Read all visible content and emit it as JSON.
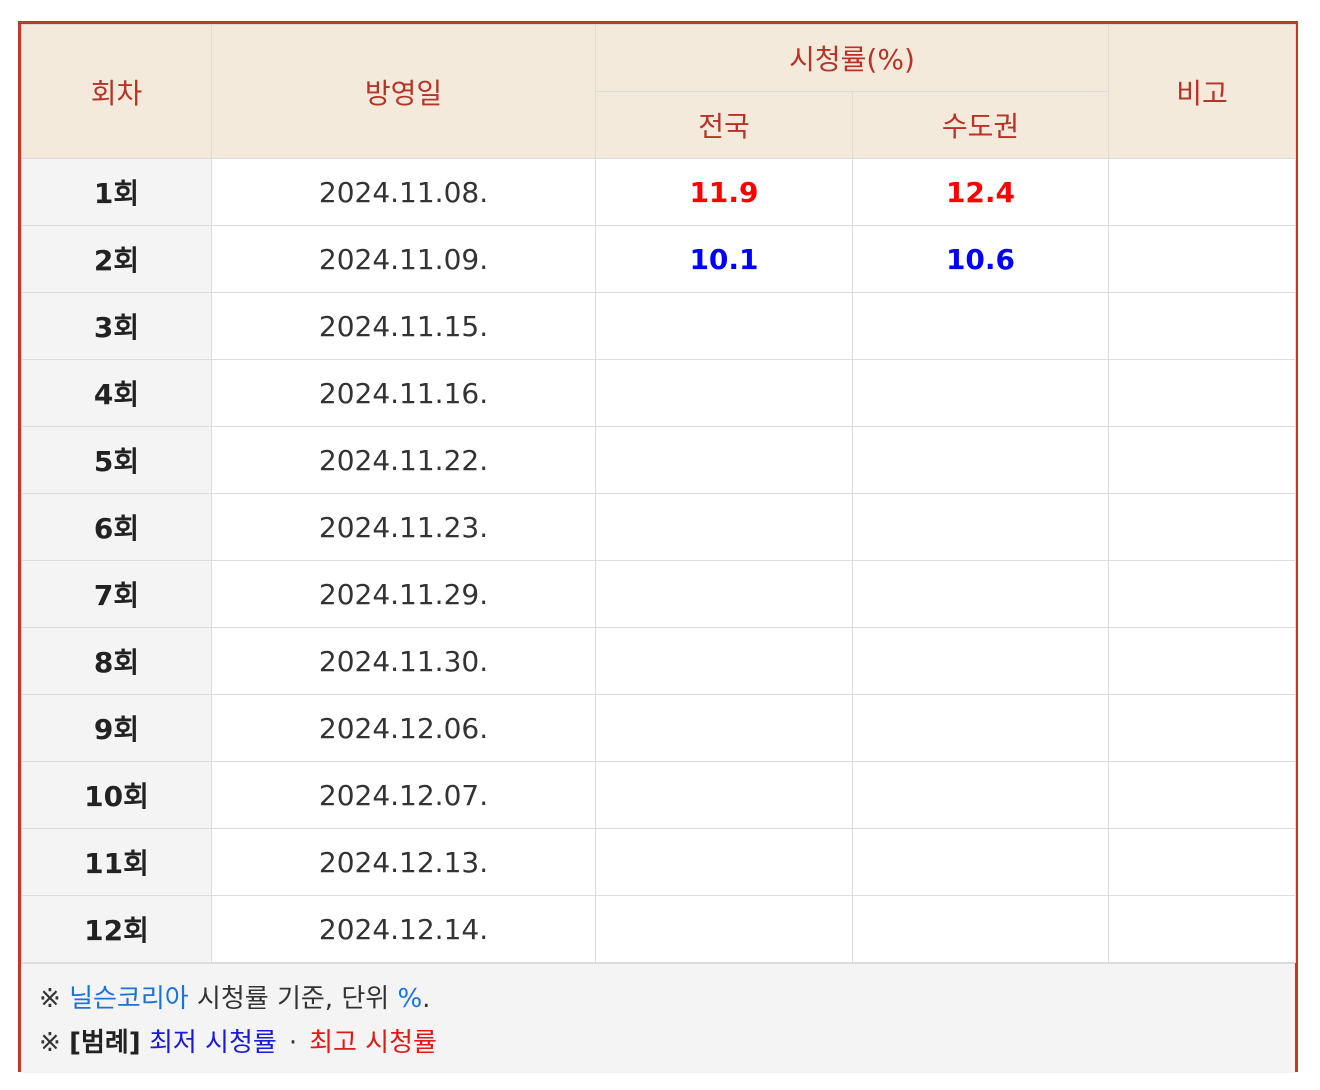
{
  "table": {
    "headers": {
      "episode": "회차",
      "air_date": "방영일",
      "ratings": "시청률(%)",
      "nationwide": "전국",
      "capital_area": "수도권",
      "remarks": "비고"
    },
    "rows": [
      {
        "episode": "1회",
        "date": "2024.11.08.",
        "nationwide": "11.9",
        "capital": "12.4",
        "remark": ""
      },
      {
        "episode": "2회",
        "date": "2024.11.09.",
        "nationwide": "10.1",
        "capital": "10.6",
        "remark": ""
      },
      {
        "episode": "3회",
        "date": "2024.11.15.",
        "nationwide": "",
        "capital": "",
        "remark": ""
      },
      {
        "episode": "4회",
        "date": "2024.11.16.",
        "nationwide": "",
        "capital": "",
        "remark": ""
      },
      {
        "episode": "5회",
        "date": "2024.11.22.",
        "nationwide": "",
        "capital": "",
        "remark": ""
      },
      {
        "episode": "6회",
        "date": "2024.11.23.",
        "nationwide": "",
        "capital": "",
        "remark": ""
      },
      {
        "episode": "7회",
        "date": "2024.11.29.",
        "nationwide": "",
        "capital": "",
        "remark": ""
      },
      {
        "episode": "8회",
        "date": "2024.11.30.",
        "nationwide": "",
        "capital": "",
        "remark": ""
      },
      {
        "episode": "9회",
        "date": "2024.12.06.",
        "nationwide": "",
        "capital": "",
        "remark": ""
      },
      {
        "episode": "10회",
        "date": "2024.12.07.",
        "nationwide": "",
        "capital": "",
        "remark": ""
      },
      {
        "episode": "11회",
        "date": "2024.12.13.",
        "nationwide": "",
        "capital": "",
        "remark": ""
      },
      {
        "episode": "12회",
        "date": "2024.12.14.",
        "nationwide": "",
        "capital": "",
        "remark": ""
      }
    ]
  },
  "notes": {
    "line1": {
      "mark": "※",
      "source_link": "닐슨코리아",
      "text": " 시청률 기준, 단위 ",
      "unit": "%",
      "end": "."
    },
    "line2": {
      "mark": "※",
      "legend_label": "[범례]",
      "lowest": "최저 시청률",
      "separator": "·",
      "highest": "최고 시청률"
    }
  },
  "colors": {
    "highest": "#ff0000",
    "lowest": "#0000ff",
    "header_text": "#b83227",
    "header_bg": "#f3eadb",
    "border": "#c0392b"
  }
}
